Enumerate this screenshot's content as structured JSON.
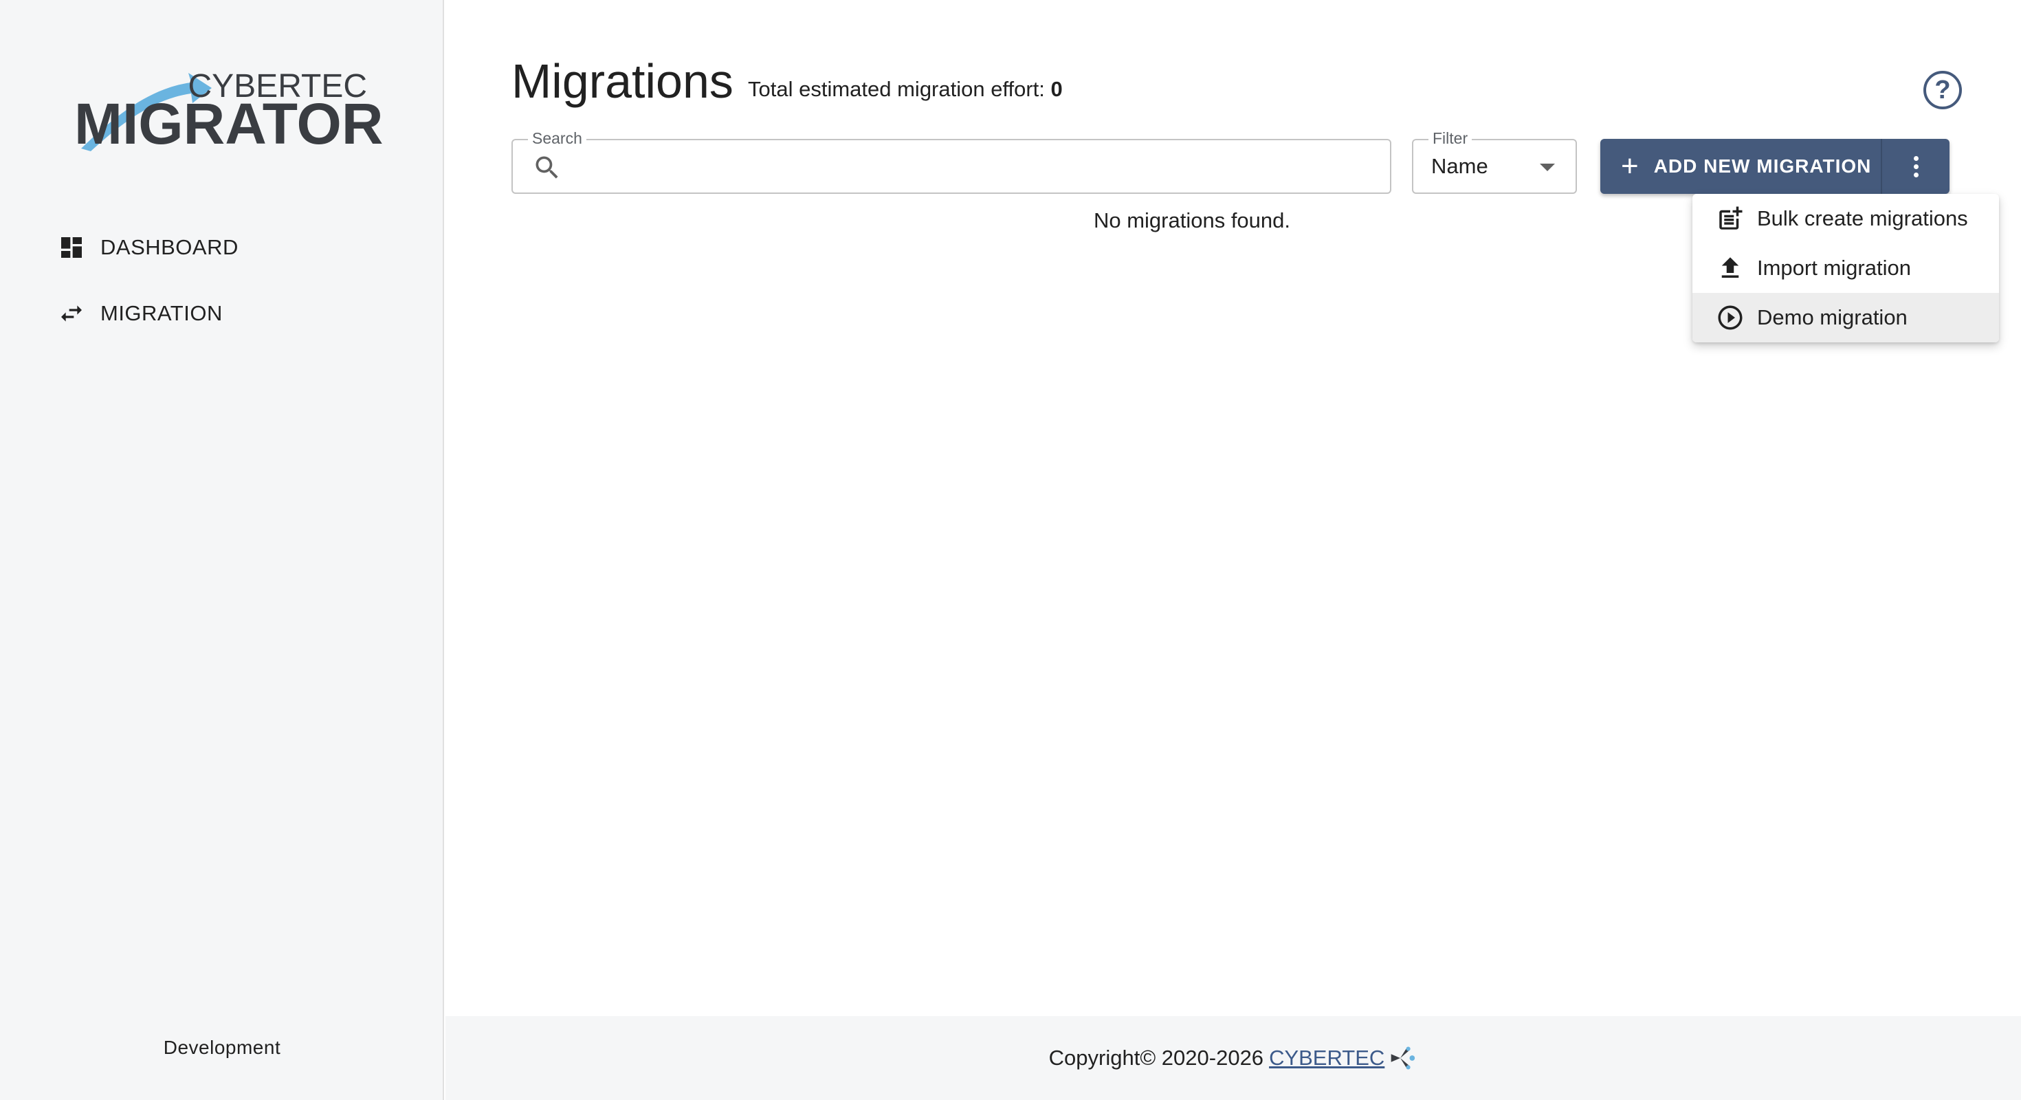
{
  "brand": {
    "logo_top": "CYBERTEC",
    "logo_bottom": "MIGRATOR",
    "arrow_color": "#6ab4e0",
    "text_color": "#3a3d42"
  },
  "sidebar": {
    "items": [
      {
        "label": "DASHBOARD",
        "icon": "dashboard-icon"
      },
      {
        "label": "MIGRATION",
        "icon": "swap-arrows-icon"
      }
    ],
    "environment": "Development"
  },
  "header": {
    "title": "Migrations",
    "effort_label": "Total estimated migration effort:",
    "effort_value": "0",
    "help_icon": "help-circle-icon"
  },
  "search": {
    "label": "Search",
    "value": "",
    "placeholder": ""
  },
  "filter": {
    "label": "Filter",
    "selected": "Name"
  },
  "actions": {
    "add_label": "ADD NEW MIGRATION",
    "more_icon": "vertical-dots-icon",
    "primary_color": "#455a7c"
  },
  "menu": {
    "items": [
      {
        "label": "Bulk create migrations",
        "icon": "post-add-icon"
      },
      {
        "label": "Import migration",
        "icon": "upload-icon"
      },
      {
        "label": "Demo migration",
        "icon": "play-circle-icon"
      }
    ]
  },
  "main": {
    "empty_message": "No migrations found."
  },
  "footer": {
    "copyright": "Copyright© 2020-2026",
    "link_text": "CYBERTEC"
  }
}
